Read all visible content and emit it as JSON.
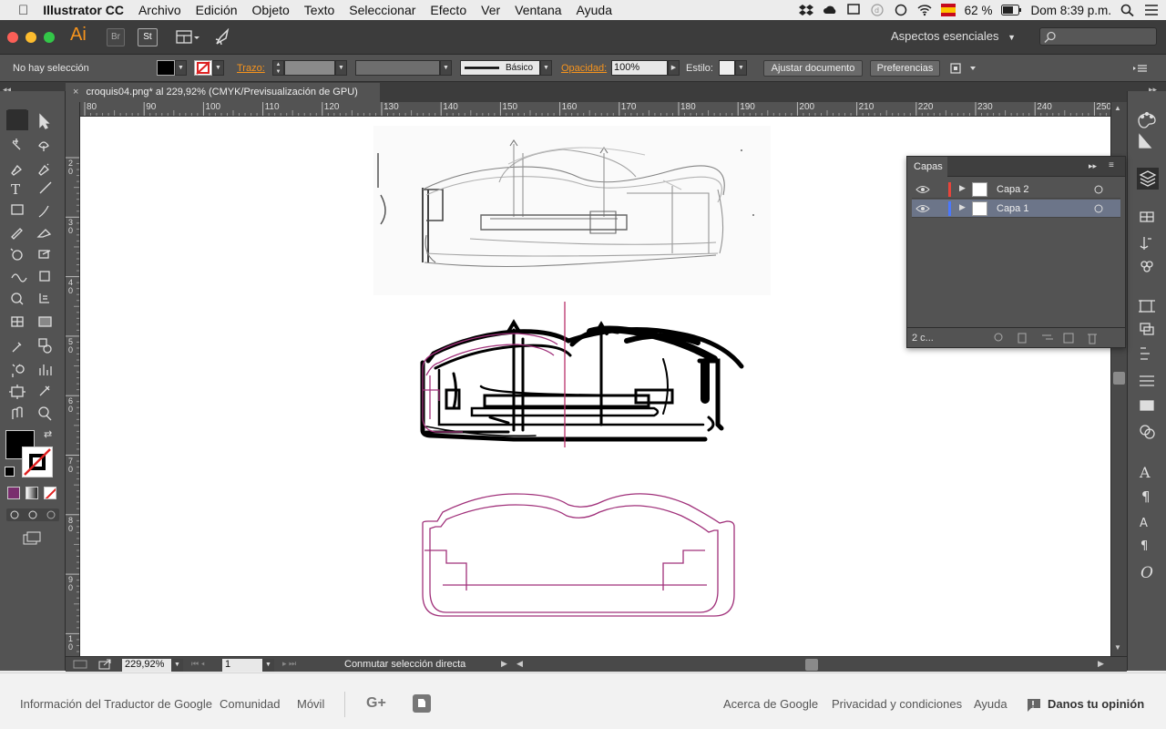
{
  "menubar": {
    "app": "Illustrator CC",
    "items": [
      "Archivo",
      "Edición",
      "Objeto",
      "Texto",
      "Seleccionar",
      "Efecto",
      "Ver",
      "Ventana",
      "Ayuda"
    ],
    "battery": "62 %",
    "clock": "Dom 8:39 p.m."
  },
  "appbar": {
    "logo": "Ai",
    "bridge": "Br",
    "stock": "St",
    "workspace": "Aspectos esenciales"
  },
  "control": {
    "selection_status": "No hay selección",
    "stroke_label": "Trazo:",
    "brush_label": "Básico",
    "opacity_label": "Opacidad:",
    "opacity_value": "100%",
    "style_label": "Estilo:",
    "adjust_doc": "Ajustar documento",
    "preferences": "Preferencias"
  },
  "document": {
    "tab_title": "croquis04.png* al 229,92% (CMYK/Previsualización de GPU)"
  },
  "rulers": {
    "h_ticks": [
      "80",
      "90",
      "100",
      "110",
      "120",
      "130",
      "140",
      "150",
      "160",
      "170",
      "180",
      "190",
      "200",
      "210",
      "220",
      "230",
      "240",
      "250"
    ],
    "v_ticks": [
      "2\n0",
      "3\n0",
      "4\n0",
      "5\n0",
      "6\n0",
      "7\n0",
      "8\n0",
      "9\n0",
      "1\n0"
    ]
  },
  "layers_panel": {
    "title": "Capas",
    "layers": [
      {
        "name": "Capa 2",
        "color": "#e8443a",
        "active": false
      },
      {
        "name": "Capa 1",
        "color": "#4a78ff",
        "active": true
      }
    ],
    "count": "2 c..."
  },
  "status": {
    "zoom": "229,92%",
    "artboard": "1",
    "tool_hint": "Conmutar selección directa"
  },
  "footer": {
    "links_left": [
      "Información del Traductor de Google",
      "Comunidad",
      "Móvil"
    ],
    "links_right": [
      "Acerca de Google",
      "Privacidad y condiciones",
      "Ayuda"
    ],
    "feedback": "Danos tu opinión"
  },
  "colors": {
    "accent": "#f7941d",
    "path": "#a0307a",
    "ui_bg": "#535353"
  }
}
